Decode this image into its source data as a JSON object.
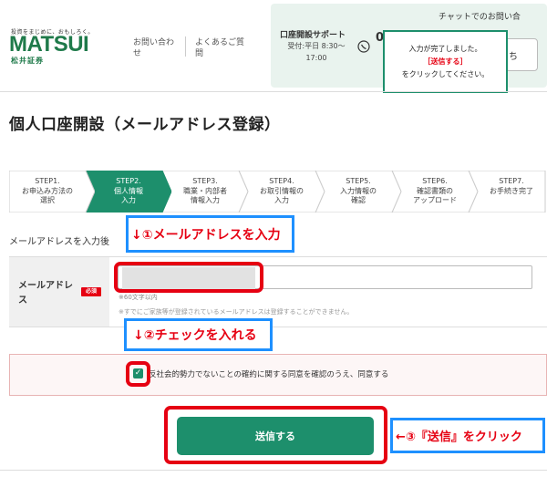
{
  "header": {
    "logo_tagline": "投資をまじめに、おもしろく。",
    "logo_name": "MATSUI",
    "logo_sub": "松井証券",
    "links": [
      "お問い合わせ",
      "よくあるご質問"
    ],
    "support_title": "口座開設サポート",
    "support_hours": "受付:平日 8:30～17:00",
    "phone_partial": "0",
    "chat_label": "チャットでのお問い合",
    "chat_btn_partial": "ち"
  },
  "popup": {
    "line1": "入力が完了しました。",
    "line2": "［送信する］",
    "line3": "をクリックしてください。"
  },
  "page": {
    "title": "個人口座開設（メールアドレス登録）"
  },
  "steps": [
    {
      "label1": "STEP1.",
      "label2": "お申込み方法の",
      "label3": "選択",
      "active": false
    },
    {
      "label1": "STEP2.",
      "label2": "個人情報",
      "label3": "入力",
      "active": true
    },
    {
      "label1": "STEP3.",
      "label2": "職業・内部者",
      "label3": "情報入力",
      "active": false
    },
    {
      "label1": "STEP4.",
      "label2": "お取引情報の",
      "label3": "入力",
      "active": false
    },
    {
      "label1": "STEP5.",
      "label2": "入力情報の",
      "label3": "確認",
      "active": false
    },
    {
      "label1": "STEP6.",
      "label2": "確認書類の",
      "label3": "アップロード",
      "active": false
    },
    {
      "label1": "STEP7.",
      "label2": "お手続き完了",
      "label3": "",
      "active": false
    }
  ],
  "form": {
    "instruction": "メールアドレスを入力後",
    "email_label": "メールアドレス",
    "required_badge": "必須",
    "email_value": "",
    "help_length": "※60文字以内",
    "help_note": "※すでにご家族等が登録されているメールアドレスは登録することができません。",
    "consent_checked": true,
    "consent_text": "反社会的勢力でないことの確約に関する同意を確認のうえ、同意する",
    "submit_label": "送信する"
  },
  "annotations": {
    "step1": "↓①メールアドレスを入力",
    "step2": "↓②チェックを入れる",
    "step3": "←③『送信』をクリック"
  },
  "colors": {
    "brand_green": "#1d8f6c",
    "logo_green": "#1f7a4a",
    "annotation_red": "#e60012",
    "annotation_blue": "#1e90ff"
  }
}
